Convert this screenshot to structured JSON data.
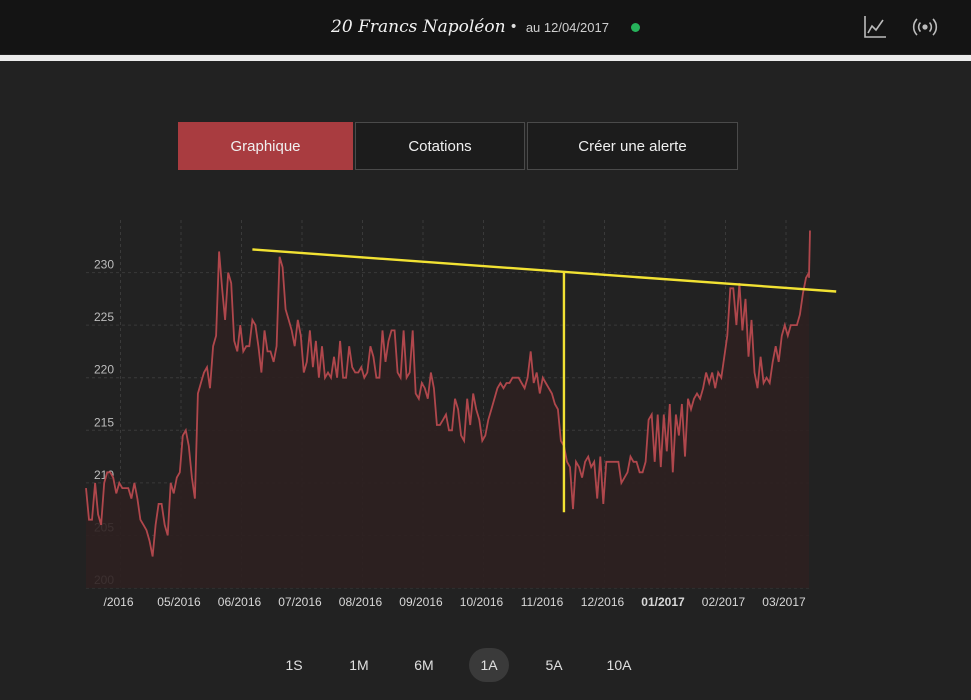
{
  "header": {
    "product": "20 Francs Napoléon",
    "bullet": "•",
    "date_text": "au 12/04/2017",
    "status_color": "#26b35b",
    "icons": [
      "chart-line-icon",
      "broadcast-icon"
    ]
  },
  "tabs": [
    {
      "label": "Graphique",
      "active": true
    },
    {
      "label": "Cotations",
      "active": false
    },
    {
      "label": "Créer une alerte",
      "active": false
    }
  ],
  "ranges": [
    {
      "label": "1S",
      "active": false
    },
    {
      "label": "1M",
      "active": false
    },
    {
      "label": "6M",
      "active": false
    },
    {
      "label": "1A",
      "active": true
    },
    {
      "label": "5A",
      "active": false
    },
    {
      "label": "10A",
      "active": false
    }
  ],
  "colors": {
    "line": "#b0474c",
    "fill": "#2e2020",
    "annotation": "#f2e233",
    "grid": "#3a3a3a"
  },
  "chart_data": {
    "type": "area",
    "ylim": [
      200,
      235
    ],
    "yticks": [
      200,
      205,
      210,
      215,
      220,
      225,
      230
    ],
    "xlim": [
      0,
      12
    ],
    "xtick_labels": [
      "/2016",
      "05/2016",
      "06/2016",
      "07/2016",
      "08/2016",
      "09/2016",
      "10/2016",
      "11/2016",
      "12/2016",
      "01/2017",
      "02/2017",
      "03/2017"
    ],
    "xtick_bold": "01/2017",
    "grid": true,
    "x": [
      0.0,
      0.05,
      0.1,
      0.15,
      0.2,
      0.25,
      0.3,
      0.35,
      0.4,
      0.45,
      0.5,
      0.55,
      0.6,
      0.65,
      0.7,
      0.75,
      0.8,
      0.85,
      0.9,
      0.95,
      1.0,
      1.05,
      1.1,
      1.15,
      1.2,
      1.25,
      1.3,
      1.35,
      1.4,
      1.45,
      1.5,
      1.55,
      1.6,
      1.65,
      1.7,
      1.75,
      1.8,
      1.85,
      1.9,
      1.95,
      2.0,
      2.05,
      2.1,
      2.15,
      2.2,
      2.25,
      2.3,
      2.35,
      2.4,
      2.45,
      2.5,
      2.55,
      2.6,
      2.65,
      2.7,
      2.75,
      2.8,
      2.85,
      2.9,
      2.95,
      3.0,
      3.05,
      3.1,
      3.15,
      3.2,
      3.25,
      3.3,
      3.35,
      3.4,
      3.45,
      3.5,
      3.55,
      3.6,
      3.65,
      3.7,
      3.75,
      3.8,
      3.85,
      3.9,
      3.95,
      4.0,
      4.05,
      4.1,
      4.15,
      4.2,
      4.25,
      4.3,
      4.35,
      4.4,
      4.45,
      4.5,
      4.55,
      4.6,
      4.65,
      4.7,
      4.75,
      4.8,
      4.85,
      4.9,
      4.95,
      5.0,
      5.05,
      5.1,
      5.15,
      5.2,
      5.25,
      5.3,
      5.35,
      5.4,
      5.45,
      5.5,
      5.55,
      5.6,
      5.65,
      5.7,
      5.75,
      5.8,
      5.85,
      5.9,
      5.95,
      6.0,
      6.05,
      6.1,
      6.15,
      6.2,
      6.25,
      6.3,
      6.35,
      6.4,
      6.45,
      6.5,
      6.55,
      6.6,
      6.65,
      6.7,
      6.75,
      6.8,
      6.85,
      6.9,
      6.95,
      7.0,
      7.05,
      7.1,
      7.15,
      7.2,
      7.25,
      7.3,
      7.35,
      7.4,
      7.45,
      7.5,
      7.55,
      7.6,
      7.65,
      7.7,
      7.75,
      7.8,
      7.85,
      7.9,
      7.95,
      8.0,
      8.05,
      8.1,
      8.15,
      8.2,
      8.25,
      8.3,
      8.35,
      8.4,
      8.45,
      8.5,
      8.55,
      8.6,
      8.65,
      8.7,
      8.75,
      8.8,
      8.85,
      8.9,
      8.95,
      9.0,
      9.05,
      9.1,
      9.15,
      9.2,
      9.25,
      9.3,
      9.35,
      9.4,
      9.45,
      9.5,
      9.55,
      9.6,
      9.65,
      9.7,
      9.75,
      9.8,
      9.85,
      9.9,
      9.95,
      10.0,
      10.05,
      10.1,
      10.15,
      10.2,
      10.25,
      10.3,
      10.35,
      10.4,
      10.45,
      10.5,
      10.55,
      10.6,
      10.65,
      10.7,
      10.75,
      10.8,
      10.85,
      10.9,
      10.95,
      11.0,
      11.05,
      11.1,
      11.15,
      11.2,
      11.25,
      11.3,
      11.35,
      11.4,
      11.45,
      11.5,
      11.55,
      11.6,
      11.65,
      11.7,
      11.75,
      11.8,
      11.85,
      11.9,
      11.95
    ],
    "y": [
      209.5,
      206.5,
      206.5,
      210,
      207,
      206,
      210,
      211,
      211,
      210.5,
      209,
      210,
      209.5,
      209.5,
      209.5,
      208.5,
      210,
      208.5,
      206.5,
      206,
      205.5,
      204.5,
      203,
      206,
      208,
      208,
      206,
      205,
      210,
      209,
      210.5,
      211,
      214.5,
      215,
      213.5,
      210.5,
      208.5,
      218.5,
      219.5,
      220.5,
      221,
      219,
      223,
      224,
      232,
      228.5,
      225.5,
      230,
      229,
      223.5,
      222.5,
      225,
      222.5,
      223,
      223,
      225.5,
      225,
      223,
      220.5,
      224.5,
      222.5,
      222.5,
      221.5,
      223,
      231.5,
      230.5,
      226.5,
      225.5,
      224.5,
      223,
      225.5,
      224,
      220.5,
      221.5,
      224.5,
      221,
      223.5,
      220,
      223,
      220,
      220.5,
      220,
      222,
      220,
      223.5,
      220,
      220,
      223,
      221,
      220.5,
      220.5,
      221,
      220,
      220.5,
      223,
      222,
      220,
      220,
      224.5,
      221.5,
      223.5,
      224.5,
      224.5,
      220.5,
      220,
      224.5,
      220,
      220.5,
      224.5,
      218.5,
      218,
      219.5,
      219,
      218,
      220.5,
      219,
      215.5,
      215.5,
      216,
      216.5,
      215,
      215,
      218,
      217,
      214.5,
      214,
      218,
      215.5,
      218.5,
      217,
      216,
      214,
      214.5,
      216,
      217,
      218,
      219,
      219.5,
      219,
      219.5,
      219.5,
      220,
      220,
      220,
      219.5,
      219,
      220,
      222.5,
      219.5,
      220.5,
      218.5,
      220,
      219.5,
      219,
      218.5,
      217.5,
      217,
      214,
      213.5,
      212,
      211.5,
      207.5,
      212,
      211.5,
      210.5,
      212,
      212.5,
      211.5,
      212,
      208.5,
      212.5,
      208,
      212,
      212,
      212,
      212,
      212,
      210,
      210.5,
      211,
      212.5,
      212,
      212,
      211,
      211,
      212,
      216,
      216.5,
      212,
      216.5,
      211.5,
      216.5,
      213,
      217.5,
      211,
      216.5,
      214.5,
      217.5,
      212.5,
      218,
      217,
      218,
      218.5,
      218,
      219,
      220.5,
      219.5,
      220.5,
      219,
      220.5,
      220,
      222,
      224,
      228.5,
      228.5,
      225,
      229,
      224.5,
      227.5,
      222,
      225.5,
      220.5,
      219,
      222,
      219.5,
      220,
      219.5,
      221.5,
      223,
      221.5,
      224,
      225,
      224,
      225,
      225,
      225,
      226,
      228,
      229.5,
      230,
      229.5,
      229.5,
      229.5,
      229.5
    ]
  },
  "annotation": {
    "trend_from": [
      2.75,
      232.2
    ],
    "trend_to": [
      12.4,
      228.2
    ],
    "drop_at_x": 7.9,
    "drop_to_y": 207.2
  }
}
